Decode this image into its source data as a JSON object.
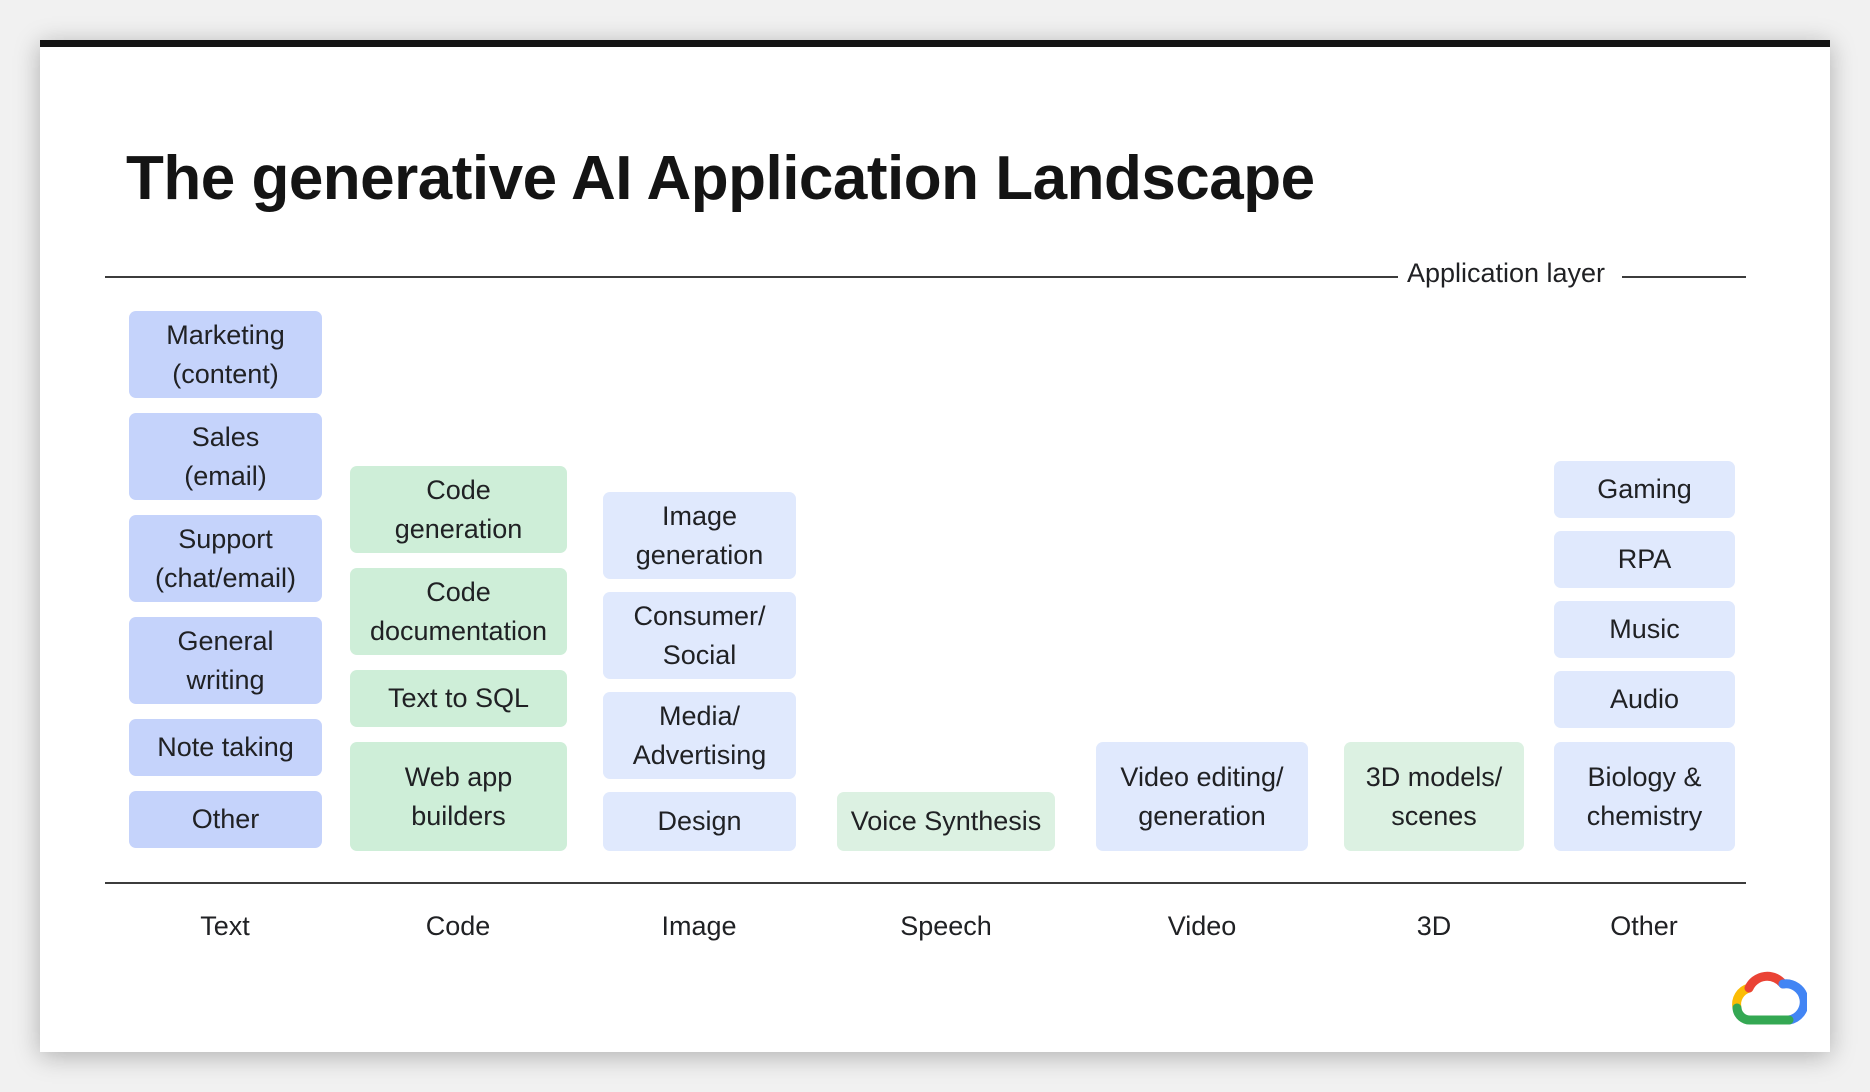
{
  "title": "The generative AI Application Landscape",
  "layer_label": "Application layer",
  "colors": {
    "text_box": "#c5d3fb",
    "code_box": "#ceeed8",
    "image_box": "#e0e9fd",
    "speech_box": "#dcf1e2"
  },
  "categories": {
    "text": "Text",
    "code": "Code",
    "image": "Image",
    "speech": "Speech",
    "video": "Video",
    "3d": "3D",
    "other": "Other"
  },
  "columns": {
    "text": [
      "Marketing\n(content)",
      "Sales\n(email)",
      "Support\n(chat/email)",
      "General\nwriting",
      "Note taking",
      "Other"
    ],
    "code": [
      "Code\ngeneration",
      "Code\ndocumentation",
      "Text to SQL",
      "Web app\nbuilders"
    ],
    "image": [
      "Image\ngeneration",
      "Consumer/\nSocial",
      "Media/\nAdvertising",
      "Design"
    ],
    "speech": [
      "Voice Synthesis"
    ],
    "video": [
      "Video editing/\ngeneration"
    ],
    "3d": [
      "3D models/\nscenes"
    ],
    "other": [
      "Gaming",
      "RPA",
      "Music",
      "Audio",
      "Biology &\nchemistry"
    ]
  },
  "logo_icon": "google-cloud-logo"
}
